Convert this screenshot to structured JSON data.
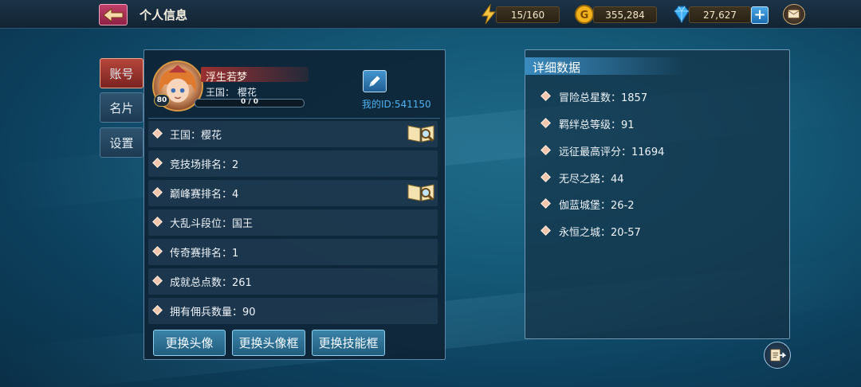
{
  "header": {
    "title": "个人信息",
    "stamina": "15/160",
    "gold": "355,284",
    "diamonds": "27,627",
    "plus_label": "+"
  },
  "tabs": [
    {
      "label": "账号",
      "active": true
    },
    {
      "label": "名片",
      "active": false
    },
    {
      "label": "设置",
      "active": false
    }
  ],
  "profile": {
    "name": "浮生若梦",
    "kingdom_line": "王国：  樱花",
    "level": "80",
    "xp": "0 / 0",
    "my_id": "我的ID:541150"
  },
  "info_rows": [
    {
      "text": "王国：樱花",
      "has_book": true
    },
    {
      "text": "竞技场排名：2",
      "has_book": false
    },
    {
      "text": "巅峰赛排名：4",
      "has_book": true
    },
    {
      "text": "大乱斗段位：国王",
      "has_book": false
    },
    {
      "text": "传奇赛排名：1",
      "has_book": false
    },
    {
      "text": "成就总点数：261",
      "has_book": false
    },
    {
      "text": "拥有佣兵数量：90",
      "has_book": false
    }
  ],
  "buttons": {
    "change_avatar": "更换头像",
    "change_frame": "更换头像框",
    "change_skill_frame": "更换技能框"
  },
  "details": {
    "title": "详细数据",
    "stats": [
      "冒险总星数：1857",
      "羁绊总等级：91",
      "远征最高评分：11694",
      "无尽之路：44",
      "伽蓝城堡：26-2",
      "永恒之城：20-57"
    ]
  },
  "colors": {
    "accent_blue": "#4fb2f0",
    "active_tab": "#b5473b",
    "diamond_marker": "#f2c7ad"
  }
}
